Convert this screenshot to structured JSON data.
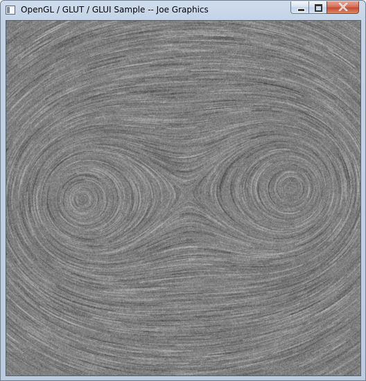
{
  "window": {
    "title": "OpenGL / GLUT / GLUI Sample -- Joe Graphics",
    "icon": "application-window-icon"
  },
  "controls": {
    "minimize_icon": "minimize-icon",
    "maximize_icon": "restore-icon",
    "close_icon": "close-icon",
    "close_color": "#c64a31"
  },
  "viewport": {
    "content": "line integral convolution flow field rendering",
    "background_color": "#808080",
    "critical_points": 2
  }
}
